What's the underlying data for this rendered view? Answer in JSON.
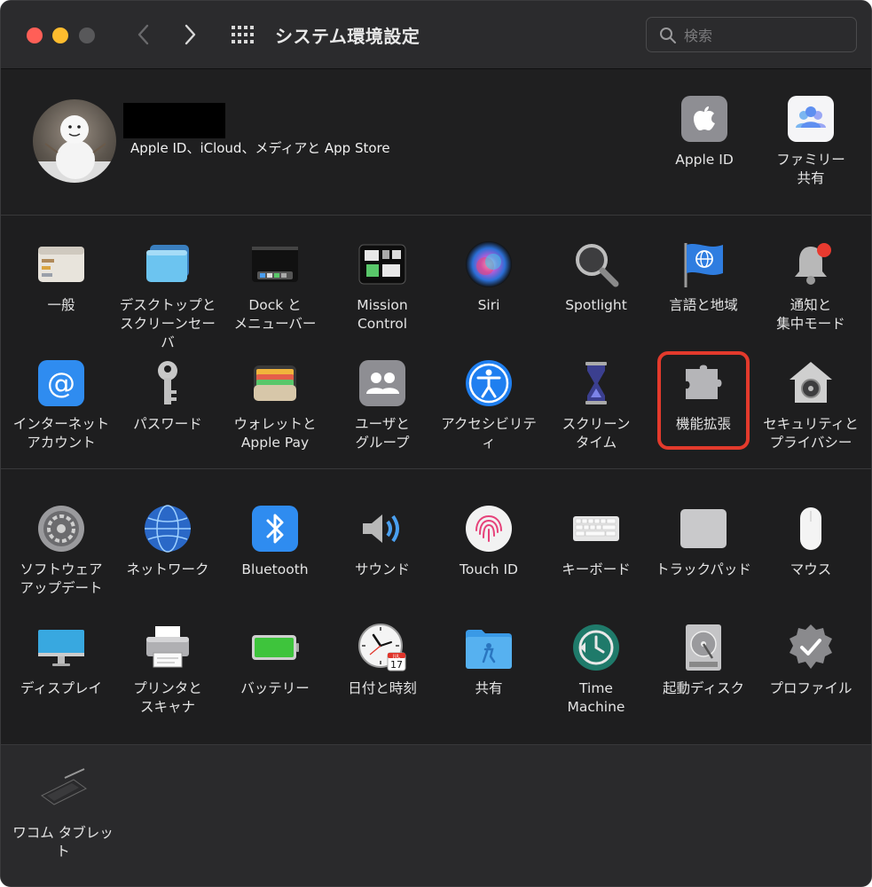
{
  "window": {
    "title": "システム環境設定"
  },
  "search": {
    "placeholder": "検索"
  },
  "account": {
    "subtitle": "Apple ID、iCloud、メディアと App Store"
  },
  "account_items": [
    {
      "label": "Apple ID",
      "icon": "apple-icon"
    },
    {
      "label": "ファミリー\n共有",
      "icon": "family-icon"
    }
  ],
  "row1": [
    {
      "label": "一般",
      "icon": "general-icon"
    },
    {
      "label": "デスクトップと\nスクリーンセーバ",
      "icon": "desktop-icon"
    },
    {
      "label": "Dock と\nメニューバー",
      "icon": "dock-icon"
    },
    {
      "label": "Mission\nControl",
      "icon": "mission-control-icon"
    },
    {
      "label": "Siri",
      "icon": "siri-icon"
    },
    {
      "label": "Spotlight",
      "icon": "spotlight-icon"
    },
    {
      "label": "言語と地域",
      "icon": "language-icon"
    },
    {
      "label": "通知と\n集中モード",
      "icon": "notification-icon"
    }
  ],
  "row2": [
    {
      "label": "インターネット\nアカウント",
      "icon": "internet-accounts-icon"
    },
    {
      "label": "パスワード",
      "icon": "key-icon"
    },
    {
      "label": "ウォレットと\nApple Pay",
      "icon": "wallet-icon"
    },
    {
      "label": "ユーザと\nグループ",
      "icon": "users-icon"
    },
    {
      "label": "アクセシビリティ",
      "icon": "accessibility-icon"
    },
    {
      "label": "スクリーン\nタイム",
      "icon": "hourglass-icon"
    },
    {
      "label": "機能拡張",
      "icon": "extensions-icon"
    },
    {
      "label": "セキュリティと\nプライバシー",
      "icon": "security-icon"
    }
  ],
  "row3": [
    {
      "label": "ソフトウェア\nアップデート",
      "icon": "software-update-icon"
    },
    {
      "label": "ネットワーク",
      "icon": "network-icon"
    },
    {
      "label": "Bluetooth",
      "icon": "bluetooth-icon"
    },
    {
      "label": "サウンド",
      "icon": "sound-icon"
    },
    {
      "label": "Touch ID",
      "icon": "fingerprint-icon"
    },
    {
      "label": "キーボード",
      "icon": "keyboard-icon"
    },
    {
      "label": "トラックパッド",
      "icon": "trackpad-icon"
    },
    {
      "label": "マウス",
      "icon": "mouse-icon"
    }
  ],
  "row4": [
    {
      "label": "ディスプレイ",
      "icon": "display-icon"
    },
    {
      "label": "プリンタと\nスキャナ",
      "icon": "printer-icon"
    },
    {
      "label": "バッテリー",
      "icon": "battery-icon"
    },
    {
      "label": "日付と時刻",
      "icon": "clock-icon"
    },
    {
      "label": "共有",
      "icon": "sharing-icon"
    },
    {
      "label": "Time\nMachine",
      "icon": "time-machine-icon"
    },
    {
      "label": "起動ディスク",
      "icon": "startup-disk-icon"
    },
    {
      "label": "プロファイル",
      "icon": "profiles-icon"
    }
  ],
  "third_party": [
    {
      "label": "ワコム タブレット",
      "icon": "tablet-icon"
    }
  ],
  "calendar_badge": {
    "month": "JUL",
    "day": "17"
  },
  "colors": {
    "highlight": "#e33a2c",
    "accent": "#0a84ff"
  }
}
